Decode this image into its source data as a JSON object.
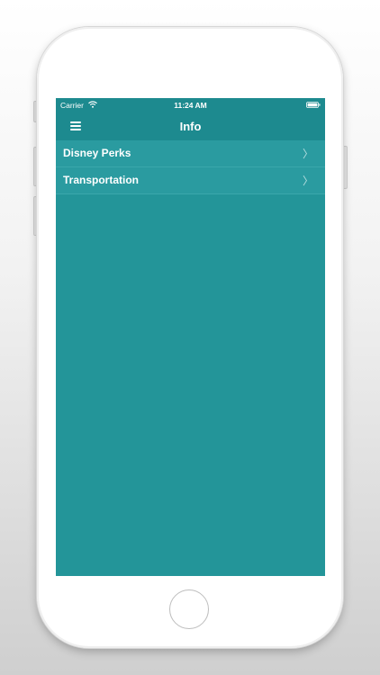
{
  "status_bar": {
    "carrier": "Carrier",
    "time": "11:24 AM"
  },
  "nav": {
    "title": "Info"
  },
  "list": {
    "items": [
      {
        "label": "Disney Perks"
      },
      {
        "label": "Transportation"
      }
    ]
  },
  "icons": {
    "menu": "menu-icon",
    "wifi": "wifi-icon",
    "battery": "battery-icon",
    "chevron": "chevron-right-icon"
  },
  "colors": {
    "bar": "#1d8a8f",
    "screen": "#239599",
    "row": "#2a9ba0"
  }
}
